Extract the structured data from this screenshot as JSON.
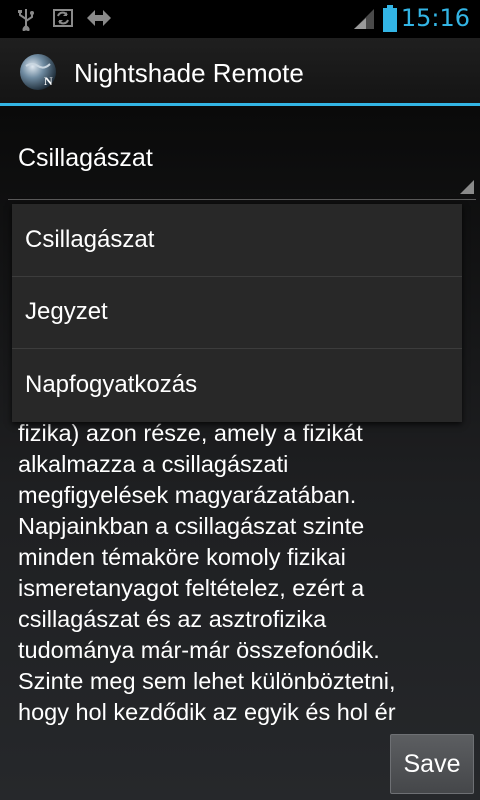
{
  "status_bar": {
    "time": "15:16",
    "accent_color": "#33b5e5",
    "icons": [
      "usb-icon",
      "sync-icon",
      "transfer-icon",
      "signal-icon",
      "battery-icon"
    ]
  },
  "action_bar": {
    "title": "Nightshade Remote",
    "icon": "nightshade-logo-icon",
    "logo_text": "N"
  },
  "spinner": {
    "selected": "Csillagászat"
  },
  "dropdown": {
    "items": [
      {
        "label": "Csillagászat"
      },
      {
        "label": "Jegyzet"
      },
      {
        "label": "Napfogyatkozás"
      }
    ]
  },
  "body_text": {
    "lines": [
      "fizika) azon része, amely a fizikát",
      "alkalmazza a csillagászati",
      "megfigyelések magyarázatában.",
      "Napjainkban a csillagászat szinte",
      "minden témaköre komoly fizikai",
      "ismeretanyagot feltételez, ezért a",
      "csillagászat és az asztrofizika",
      "tudománya már-már összefonódik.",
      "Szinte meg sem lehet különböztetni,",
      "hogy hol kezdődik az egyik és hol ér"
    ]
  },
  "footer": {
    "save_label": "Save"
  }
}
